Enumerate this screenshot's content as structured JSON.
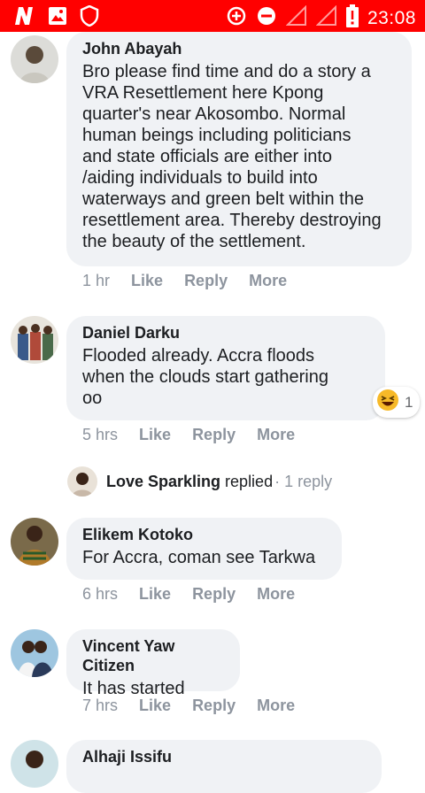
{
  "status_bar": {
    "time": "23:08",
    "icons": [
      "n-app-icon",
      "gallery-icon",
      "shield-icon",
      "data-saver-icon",
      "do-not-disturb-icon",
      "signal-icon",
      "signal-icon-2",
      "battery-icon"
    ]
  },
  "comments": [
    {
      "author": "John Abayah",
      "text": "Bro please find time and do a story a\nVRA Resettlement here Kpong\nquarter's near Akosombo. Normal\nhuman beings including politicians\nand state officials are either into\n/aiding individuals to build into\nwaterways and green belt within the\nresettlement area. Thereby destroying\nthe beauty of the settlement.",
      "time": "1 hr",
      "like": "Like",
      "reply": "Reply",
      "more": "More"
    },
    {
      "author": "Daniel Darku",
      "text": "Flooded already. Accra floods\nwhen the clouds start gathering\noo",
      "time": "5 hrs",
      "like": "Like",
      "reply": "Reply",
      "more": "More",
      "reaction_count": "1",
      "reply_author": "Love Sparkling",
      "reply_word": "replied",
      "reply_count": " · 1 reply"
    },
    {
      "author": "Elikem Kotoko",
      "text": "For Accra, coman see Tarkwa",
      "time": "6 hrs",
      "like": "Like",
      "reply": "Reply",
      "more": "More"
    },
    {
      "author": "Vincent Yaw Citizen",
      "text": "It has started",
      "time": "7 hrs",
      "like": "Like",
      "reply": "Reply",
      "more": "More"
    },
    {
      "author": "Alhaji Issifu"
    }
  ],
  "colors": {
    "status_bar": "#ff0000",
    "bubble": "#f0f2f5",
    "meta": "#8d949e",
    "text": "#1c1e21"
  }
}
